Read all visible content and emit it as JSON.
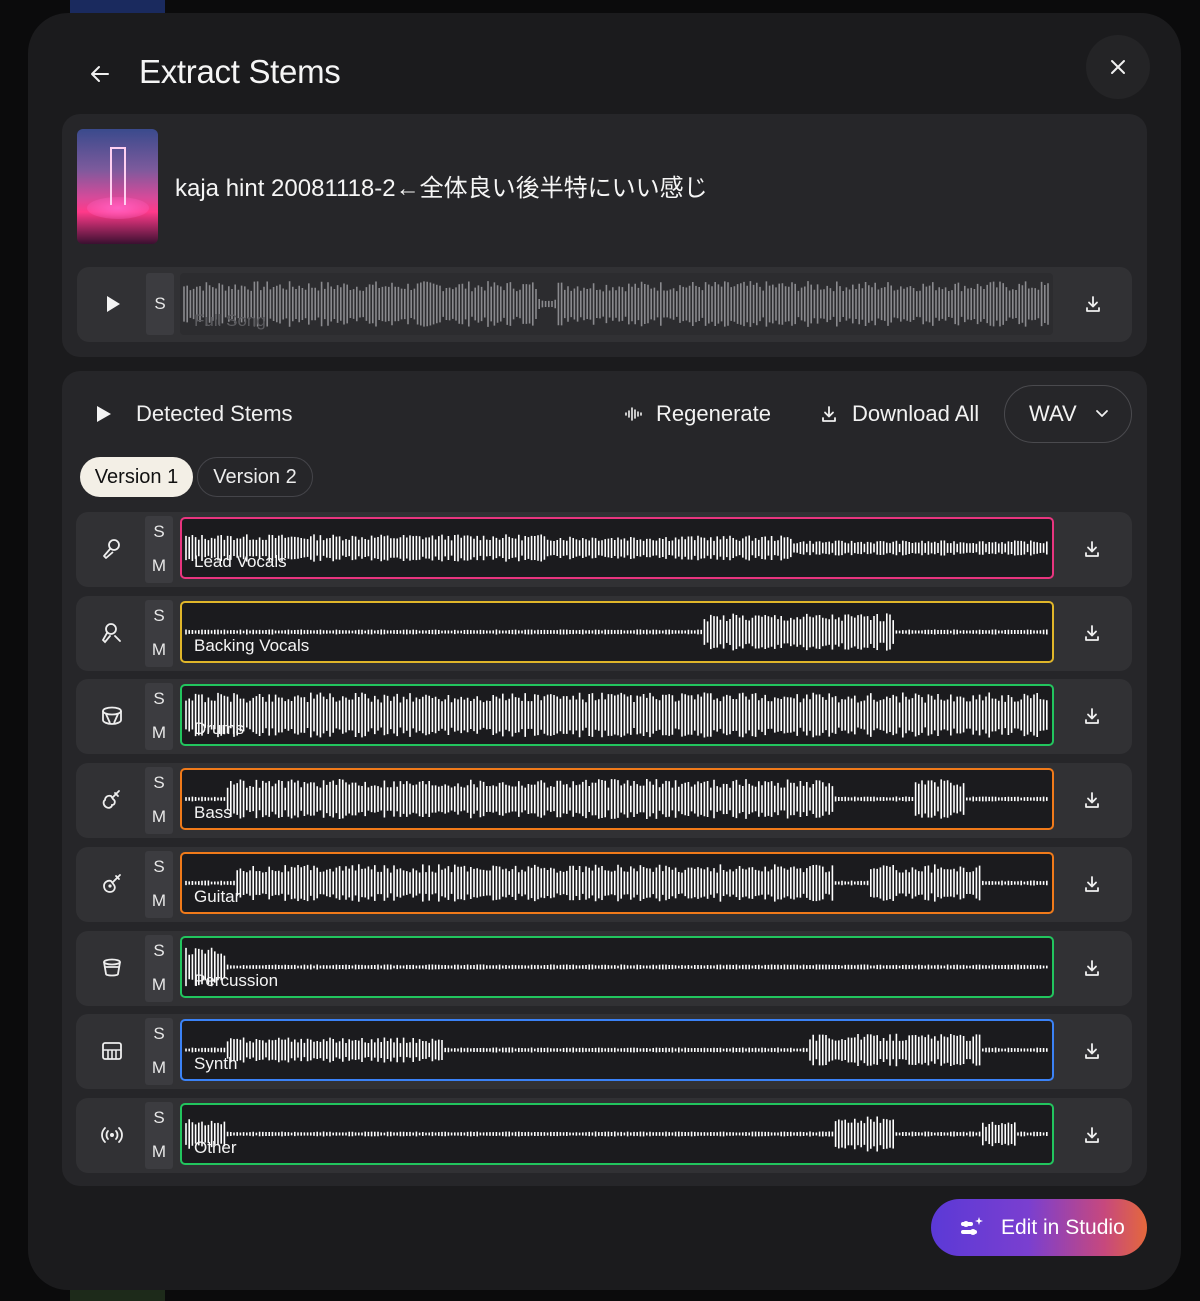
{
  "header": {
    "title": "Extract Stems"
  },
  "song": {
    "title": "kaja hint 20081118-2←全体良い後半特にいい感じ",
    "full_track": {
      "solo_label": "S",
      "label": "Full Song"
    }
  },
  "stems_panel": {
    "title": "Detected Stems",
    "regenerate_label": "Regenerate",
    "download_all_label": "Download All",
    "format": {
      "selected": "WAV"
    },
    "tabs": [
      {
        "label": "Version 1",
        "active": true
      },
      {
        "label": "Version 2",
        "active": false
      }
    ],
    "stems": [
      {
        "label": "Lead Vocals",
        "icon": "microphone-icon",
        "color": "#e8357f",
        "solo": "S",
        "mute": "M"
      },
      {
        "label": "Backing Vocals",
        "icon": "person-mic-icon",
        "color": "#e0b62a",
        "solo": "S",
        "mute": "M"
      },
      {
        "label": "Drums",
        "icon": "drum-icon",
        "color": "#22c55e",
        "solo": "S",
        "mute": "M"
      },
      {
        "label": "Bass",
        "icon": "bass-guitar-icon",
        "color": "#f07a1a",
        "solo": "S",
        "mute": "M"
      },
      {
        "label": "Guitar",
        "icon": "guitar-icon",
        "color": "#f07a1a",
        "solo": "S",
        "mute": "M"
      },
      {
        "label": "Percussion",
        "icon": "percussion-icon",
        "color": "#22c55e",
        "solo": "S",
        "mute": "M"
      },
      {
        "label": "Synth",
        "icon": "keyboard-icon",
        "color": "#3b82f6",
        "solo": "S",
        "mute": "M"
      },
      {
        "label": "Other",
        "icon": "broadcast-icon",
        "color": "#22c55e",
        "solo": "S",
        "mute": "M"
      }
    ]
  },
  "footer": {
    "studio_button_label": "Edit in Studio"
  }
}
